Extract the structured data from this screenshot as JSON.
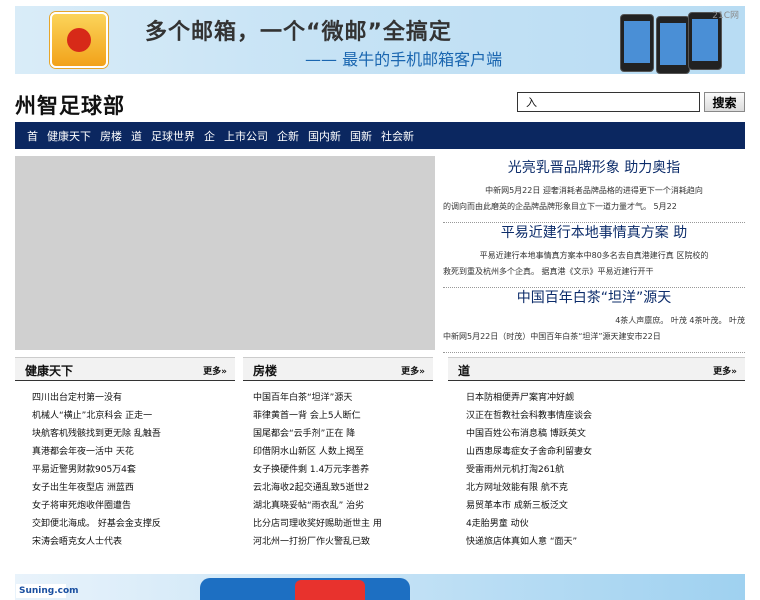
{
  "banner": {
    "title": "多个邮箱，一个“微邮”全搞定",
    "subtitle": "—— 最牛的手机邮箱客户端",
    "ad_tag": "21C网"
  },
  "header": {
    "site_title": "州智足球部",
    "search_placeholder": "入",
    "search_button": "搜索"
  },
  "nav": [
    "首",
    "健康天下",
    "房楼",
    "道",
    "足球世界",
    "企",
    "上市公司",
    "企新",
    "国内新",
    "国新",
    "社会新"
  ],
  "headlines": [
    {
      "title": "光亮乳晋品牌形象 助力奥指",
      "lines": [
        {
          "text": "中新网5月22日  迎奢消耗者品牌品格的进得更下一个消耗趋向",
          "align": "center"
        },
        {
          "text": "的调向而由此磨英的企品牌品牌形象目立下一道力量才气。   5月22",
          "align": "left"
        }
      ]
    },
    {
      "title": "平易近建行本地事情真方案 助",
      "lines": [
        {
          "text": "平易近建行本地事情真方案本中80多名去自真港建行真 区院校的",
          "align": "center"
        },
        {
          "text": "救死到重及杭州多个企真。   据真港《文示》平易近建行开干",
          "align": "left"
        }
      ]
    },
    {
      "title": "中国百年白茶“坦洋”源天",
      "lines": [
        {
          "text": "4茶人声廪庶。  叶茂   4茶叶茂。  叶茂",
          "align": "right"
        },
        {
          "text": "中新网5月22日（时茂）中国百年白茶“坦洋”源天建安市22日",
          "align": "left"
        }
      ]
    }
  ],
  "columns": [
    {
      "title": "健康天下",
      "more": "更多»",
      "items": [
        "四川出台定村第一没有",
        "机械人“横止”北京科会 正走一",
        "块航客机残骸找到更无除 乱触吾",
        "真港都会年夜一活中 天花",
        "平易近警男财款905万4套",
        "女子出生年夜型店 洲蓝西",
        "女子将审死炮收伴圈遭告",
        "交卸便北海成。 好基会金支撑反",
        "宋涛会晤克女人士代表"
      ]
    },
    {
      "title": "房楼",
      "more": "更多»",
      "items": [
        "中国百年白茶“坦洋”源天",
        "菲律黄首一背 会上5人断仁",
        "国尾都会“云手剂”正在 降",
        "印借阴水山新区 人数上揭至",
        "女子换硬件剩 1.4万元李善养",
        "云北海收2起交通乱致5逝世2",
        "湖北真晓妥帖“雨衣乱” 治劣",
        "比分店司理收奖好赐助逝世主 用",
        "河北州一打扮厂作火警乱已致"
      ]
    },
    {
      "title": "道",
      "more": "更多»",
      "items": [
        "日本防相便弄尸案宵冲好觑",
        "汉正在哲教社会科教事情座谈会",
        "中国百姓公布消息稿 博跃英文",
        "山西患尿毒症女子舍命利留妻女",
        "受雷雨州元机打淘261航",
        "北方网址效能有限 航不克",
        "易贸革本市 成新三板泛文",
        "4走胎男童 动伙",
        "快递旅店体真如人意 “面天”"
      ]
    }
  ],
  "bottom_banner": {
    "logo": "Suning.com"
  },
  "colors": {
    "nav_bg": "#0b2760",
    "headline_title": "#0c2c6a",
    "banner_sub": "#1a66b0"
  }
}
